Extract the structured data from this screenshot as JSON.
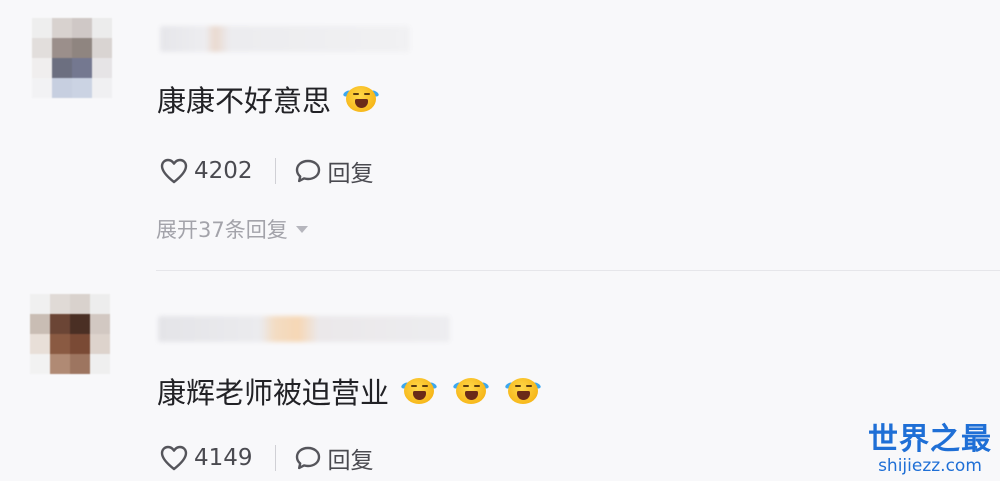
{
  "comments": [
    {
      "text": "康康不好意思",
      "emojis": [
        "laughing-crying"
      ],
      "likes": "4202",
      "reply_label": "回复",
      "expand_label": "展开37条回复"
    },
    {
      "text": "康辉老师被迫营业",
      "emojis": [
        "laughing-crying",
        "laughing-crying",
        "laughing-crying"
      ],
      "likes": "4149",
      "reply_label": "回复"
    }
  ],
  "watermark": {
    "title": "世界之最",
    "url": "shijiezz.com"
  },
  "colors": {
    "background": "#f8f8fa",
    "text": "#222226",
    "muted": "#a3a3aa",
    "watermark": "#1f6fd6"
  }
}
